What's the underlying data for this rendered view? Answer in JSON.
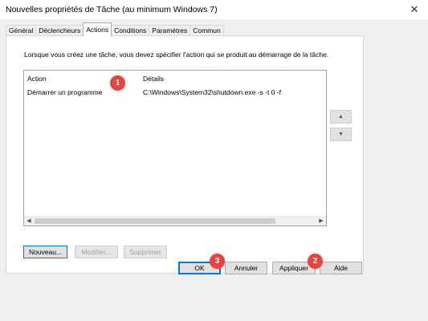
{
  "window": {
    "title": "Nouvelles propriétés de Tâche (au minimum Windows 7)",
    "close_glyph": "✕"
  },
  "tabs": [
    {
      "label": "Général"
    },
    {
      "label": "Déclencheurs"
    },
    {
      "label": "Actions"
    },
    {
      "label": "Conditions"
    },
    {
      "label": "Paramètres"
    },
    {
      "label": "Commun"
    }
  ],
  "active_tab": "Actions",
  "actions_panel": {
    "intro": "Lorsque vous créez une tâche, vous devez spécifier l'action qui se produit au démarrage de la tâche.",
    "columns": [
      "Action",
      "Détails"
    ],
    "rows": [
      {
        "action": "Démarrer un programme",
        "details": "C:\\Windows\\System32\\shutdown.exe -s -t 0 -f"
      }
    ],
    "move_up_glyph": "▲",
    "move_down_glyph": "▼",
    "scroll_left_glyph": "◀",
    "scroll_right_glyph": "▶",
    "buttons": {
      "new": "Nouveau...",
      "edit": "Modifier...",
      "delete": "Supprimer"
    }
  },
  "footer_buttons": {
    "ok": "OK",
    "cancel": "Annuler",
    "apply": "Appliquer",
    "help": "Aide"
  },
  "annotations": [
    "1",
    "2",
    "3"
  ],
  "colors": {
    "badge": "#e9433b",
    "default_button_border": "#0078d7"
  }
}
